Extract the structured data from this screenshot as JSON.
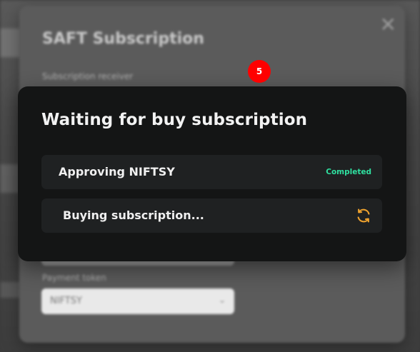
{
  "background": {
    "title": "SAFT Subscription",
    "subscription_label": "Subscription receiver",
    "payment_token_label": "Payment token",
    "payment_token_value": "NIFTSY"
  },
  "step_badge": "5",
  "dialog": {
    "title": "Waiting for buy subscription",
    "steps": [
      {
        "label": "Approving NIFTSY",
        "status": "Completed"
      },
      {
        "label": "Buying subscription..."
      }
    ]
  },
  "colors": {
    "dialog_bg": "#141515",
    "row_bg": "#1f2122",
    "completed": "#2fe0a0",
    "spinner": "#f0a32e",
    "badge": "#ff0000"
  },
  "icons": {
    "close": "close-icon",
    "spinner": "refresh-spinner-icon",
    "chevron": "chevron-down-icon"
  }
}
